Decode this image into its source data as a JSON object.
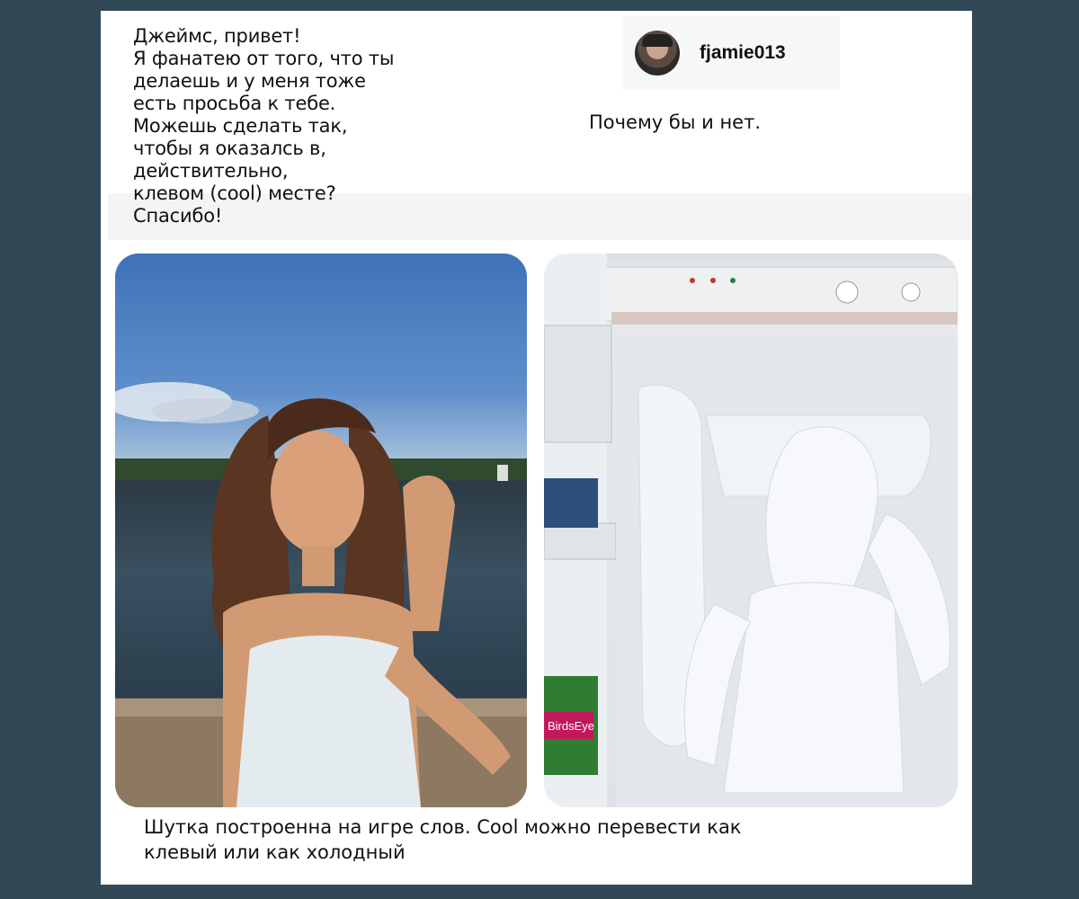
{
  "post": {
    "request_text": "Джеймс, привет!\nЯ фанатею от того, что ты\nделаешь и у меня тоже\nесть просьба к тебе.\nМожешь сделать так,\nчтобы я оказалсь в,\nдействительно,\nклевом (cool) месте?\nСпасибо!",
    "username": "fjamie013",
    "reply_text": "Почему бы и нет.",
    "caption": "Шутка построенна на игре слов. Cool можно перевести как\nклевый или как холодный"
  },
  "images": {
    "left_photo": "girl-by-lake-photo",
    "right_photo": "freezer-snow-figure-photo",
    "freezer_labels": [
      "BirdsEye"
    ]
  },
  "colors": {
    "background": "#324857",
    "card": "#ffffff",
    "text": "#111111"
  }
}
